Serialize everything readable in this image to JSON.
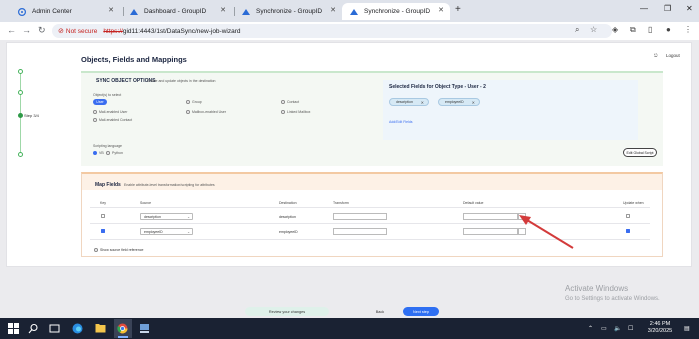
{
  "browser": {
    "tabs": [
      {
        "title": "Admin Center"
      },
      {
        "title": "Dashboard - GroupID"
      },
      {
        "title": "Synchronize - GroupID"
      },
      {
        "title": "Synchronize - GroupID"
      }
    ],
    "security_label": "Not secure",
    "url_scheme": "https://",
    "url_rest": "gid11:4443/1st/DataSync/new-job-wizard"
  },
  "stepper": {
    "current_step": "Step 3/4"
  },
  "page": {
    "title": "Objects, Fields and Mappings",
    "logout": "Logout"
  },
  "sync_options": {
    "title": "SYNC OBJECT OPTIONS",
    "hint": "Create and update objects in the destination",
    "object_type_label": "Object(s) to select",
    "radio_options": [
      {
        "label": "User",
        "selected": true
      },
      {
        "label": "Group",
        "selected": false
      },
      {
        "label": "Contact",
        "selected": false
      },
      {
        "label": "Mail-enabled User",
        "selected": false
      },
      {
        "label": "Mailbox-enabled User",
        "selected": false
      },
      {
        "label": "Linked Mailbox",
        "selected": false
      },
      {
        "label": "Mail-enabled Contact",
        "selected": false
      }
    ],
    "scripting_label": "Scripting language",
    "scripting_options": [
      {
        "label": "VB",
        "selected": true
      },
      {
        "label": "Python",
        "selected": false
      }
    ],
    "default_script_button": "Edit Global Script"
  },
  "selected_fields": {
    "title": "Selected Fields for Object Type - User - 2",
    "chips": [
      "description",
      "employeeID"
    ],
    "add_edit": "Add/Edit Fields"
  },
  "map_fields": {
    "title": "Map Fields",
    "hint": "Enable attribute-level transformation/scripting for attributes",
    "columns": [
      "Key",
      "Source",
      "Destination",
      "Transform",
      "Default value",
      "Update when"
    ],
    "rows": [
      {
        "key_checked": false,
        "source": "description",
        "destination": "description",
        "update_checked": false
      },
      {
        "key_checked": true,
        "source": "employeeID",
        "destination": "employeeID",
        "update_checked": true
      }
    ],
    "show_source_label": "Show source field reference"
  },
  "footer": {
    "review": "Review your changes",
    "back": "Back",
    "next": "Next step"
  },
  "watermark": {
    "line1": "Activate Windows",
    "line2": "Go to Settings to activate Windows."
  },
  "taskbar": {
    "time": "2:46 PM",
    "date": "3/20/2025"
  },
  "colors": {
    "accent": "#3a6df0",
    "arrow": "#d33b3b",
    "success": "#2f9a48"
  }
}
